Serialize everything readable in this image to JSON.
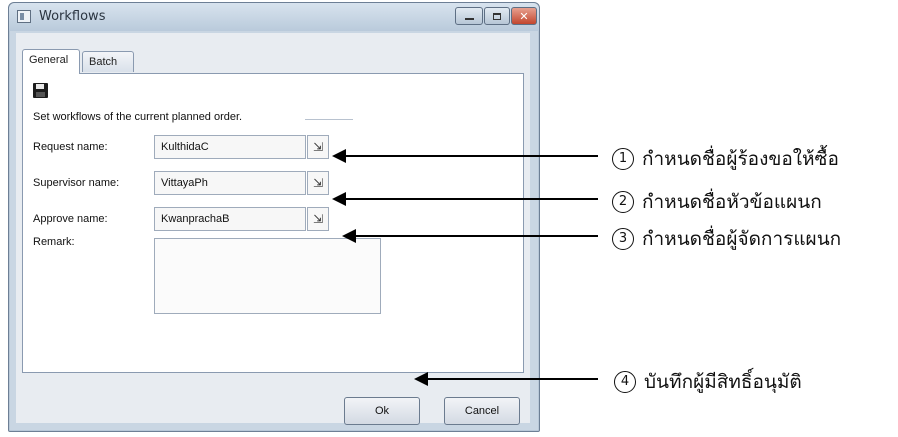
{
  "window": {
    "title": "Workflows"
  },
  "tabs": [
    {
      "label": "General"
    },
    {
      "label": "Batch"
    }
  ],
  "form": {
    "description": "Set workflows of the current planned order.",
    "request_label": "Request name:",
    "request_value": "KulthidaC",
    "supervisor_label": "Supervisor name:",
    "supervisor_value": "VittayaPh",
    "approve_label": "Approve name:",
    "approve_value": "KwanprachaB",
    "remark_label": "Remark:"
  },
  "buttons": {
    "ok": "Ok",
    "cancel": "Cancel"
  },
  "annotations": [
    {
      "number": "1",
      "text": "กำหนดชื่อผู้ร้องขอให้ซื้อ"
    },
    {
      "number": "2",
      "text": "กำหนดชื่อหัวข้อแผนก"
    },
    {
      "number": "3",
      "text": "กำหนดชื่อผู้จัดการแผนก"
    },
    {
      "number": "4",
      "text": "บันทึกผู้มีสิทธิ์อนุมัติ"
    }
  ]
}
